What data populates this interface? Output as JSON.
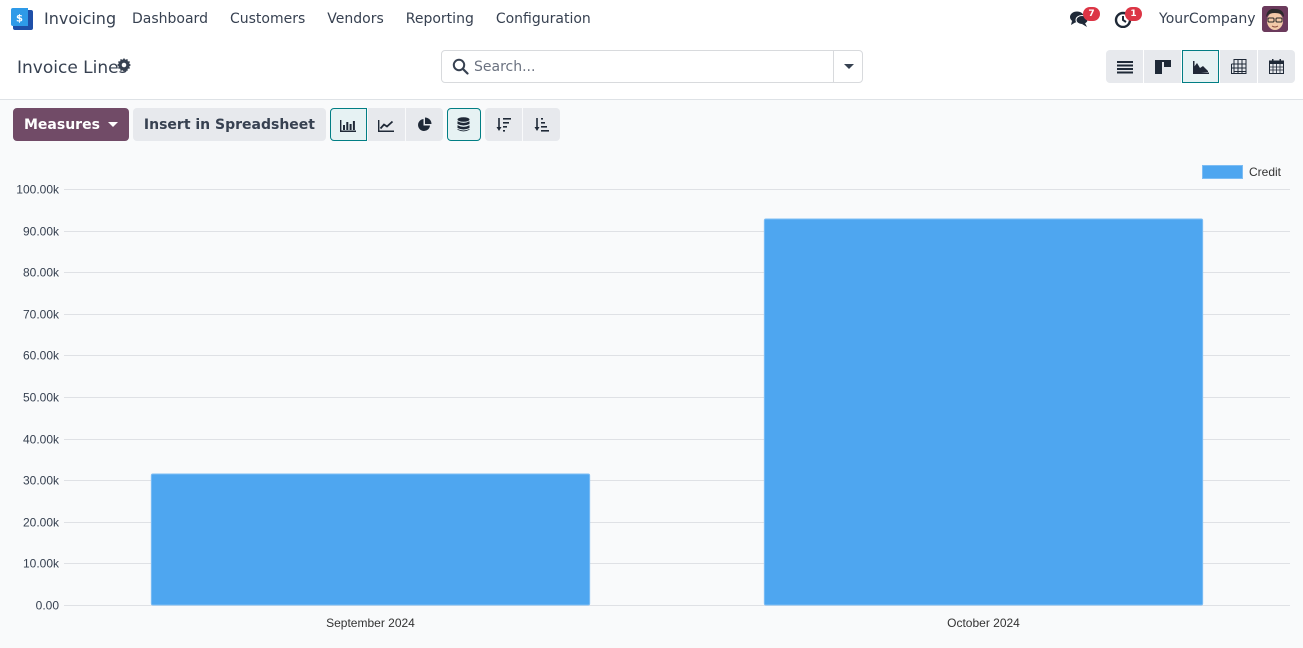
{
  "navbar": {
    "app_name": "Invoicing",
    "menu": [
      "Dashboard",
      "Customers",
      "Vendors",
      "Reporting",
      "Configuration"
    ],
    "messages_badge": "7",
    "activities_badge": "1",
    "company": "YourCompany"
  },
  "control": {
    "title": "Invoice Lines",
    "search_placeholder": "Search...",
    "views": [
      {
        "name": "list",
        "icon": "list-icon",
        "active": false
      },
      {
        "name": "kanban",
        "icon": "kanban-icon",
        "active": false
      },
      {
        "name": "graph",
        "icon": "area-chart-icon",
        "active": true
      },
      {
        "name": "pivot",
        "icon": "table-icon",
        "active": false
      },
      {
        "name": "calendar",
        "icon": "calendar-icon",
        "active": false
      }
    ]
  },
  "toolbar": {
    "measures_label": "Measures",
    "spreadsheet_label": "Insert in Spreadsheet",
    "chart_modes": [
      {
        "name": "bar",
        "icon": "bar-chart-icon",
        "active": true
      },
      {
        "name": "line",
        "icon": "line-chart-icon",
        "active": false
      },
      {
        "name": "pie",
        "icon": "pie-chart-icon",
        "active": false
      }
    ],
    "stacked_active": true,
    "sort": [
      {
        "name": "descending",
        "icon": "sort-descending-icon"
      },
      {
        "name": "ascending",
        "icon": "sort-ascending-icon"
      }
    ]
  },
  "colors": {
    "brand": "#714b67",
    "accent": "#017e84",
    "bar": "#4ea6f0",
    "badge": "#dc3545"
  },
  "chart_data": {
    "type": "bar",
    "title": "",
    "xlabel": "",
    "ylabel": "",
    "categories": [
      "September 2024",
      "October 2024"
    ],
    "series": [
      {
        "name": "Credit",
        "values": [
          31500,
          92800
        ]
      }
    ],
    "ylim": [
      0,
      100000
    ],
    "yticks": [
      0,
      10000,
      20000,
      30000,
      40000,
      50000,
      60000,
      70000,
      80000,
      90000,
      100000
    ],
    "ytick_labels": [
      "0.00",
      "10.00k",
      "20.00k",
      "30.00k",
      "40.00k",
      "50.00k",
      "60.00k",
      "70.00k",
      "80.00k",
      "90.00k",
      "100.00k"
    ],
    "grid": true,
    "legend": "top-right"
  }
}
